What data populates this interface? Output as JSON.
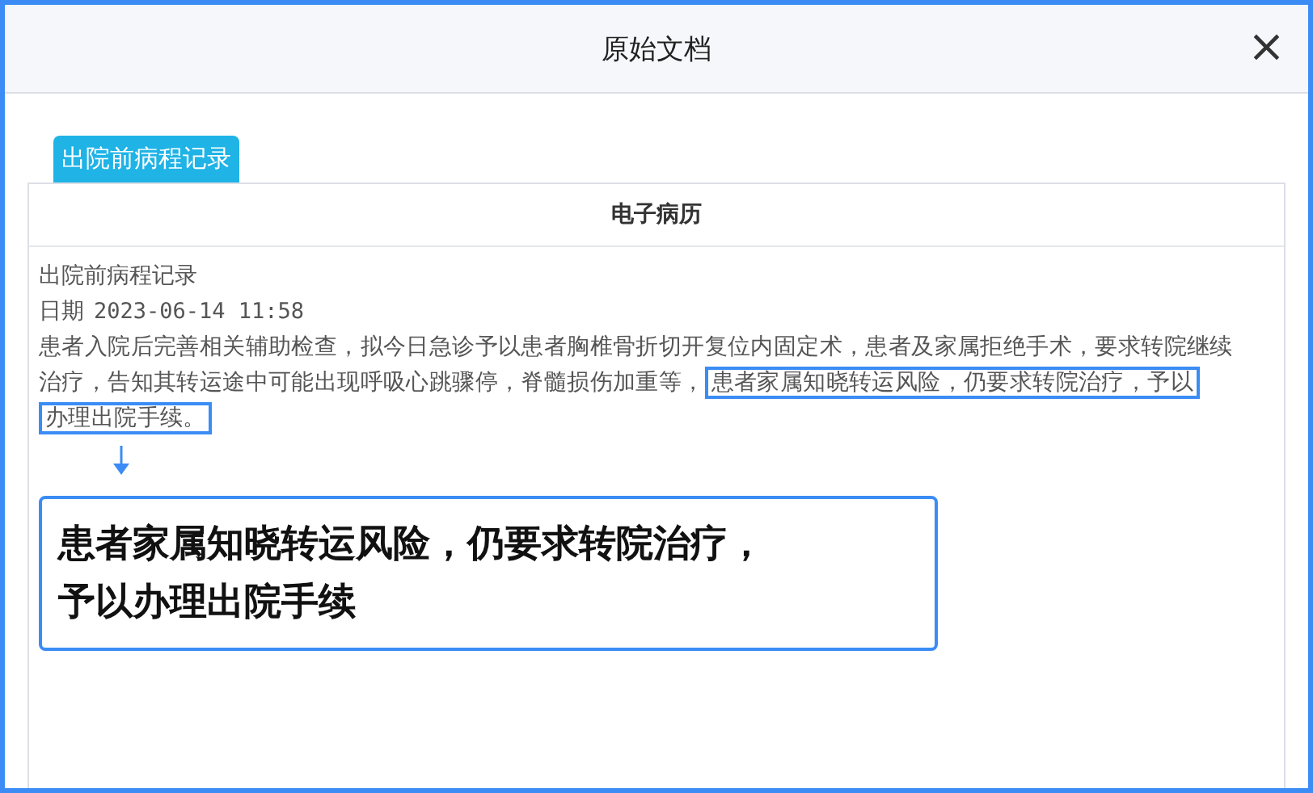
{
  "window": {
    "title": "原始文档",
    "close": "×"
  },
  "tabs": [
    {
      "label": "出院前病程记录",
      "selected": true
    }
  ],
  "document": {
    "heading": "电子病历",
    "record_title": "出院前病程记录",
    "date_label": "日期",
    "date_value": "2023-06-14 11:58",
    "body_text": "患者入院后完善相关辅助检查，拟今日急诊予以患者胸椎骨折切开复位内固定术，患者及家属拒绝手术，要求转院继续治疗，告知其转运途中可能出现呼吸心跳骤停，脊髓损伤加重等，",
    "highlighted_lines": [
      "患者家属知晓转运风险，仍要求转院治疗，予以",
      "办理出院手续。"
    ]
  },
  "callout": {
    "lines": [
      "患者家属知晓转运风险，仍要求转院治疗，",
      "予以办理出院手续"
    ]
  }
}
